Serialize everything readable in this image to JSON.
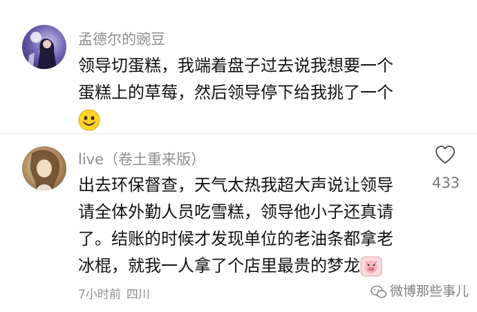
{
  "comments": [
    {
      "username": "孟德尔的豌豆",
      "lines": [
        "领导切蛋糕，我端着盘子过去说我想要一个",
        "蛋糕上的草莓，然后领导停下给我挑了一个"
      ],
      "emoji": "grinning-face-icon"
    },
    {
      "username": "live（卷土重来版）",
      "lines": [
        "出去环保督查，天气太热我超大声说让领导",
        "请全体外勤人员吃雪糕，领导他小子还真请",
        "了。结账的时候才发现单位的老油条都拿老",
        "冰棍，就我一人拿了个店里最贵的梦龙"
      ],
      "emoji": "pig-icon",
      "like_count": "433",
      "time": "7小时前",
      "location": "四川"
    }
  ],
  "watermark": "微博那些事儿",
  "colors": {
    "username": "#8d8d8d",
    "text": "#111111",
    "meta": "#8d8d8d"
  }
}
